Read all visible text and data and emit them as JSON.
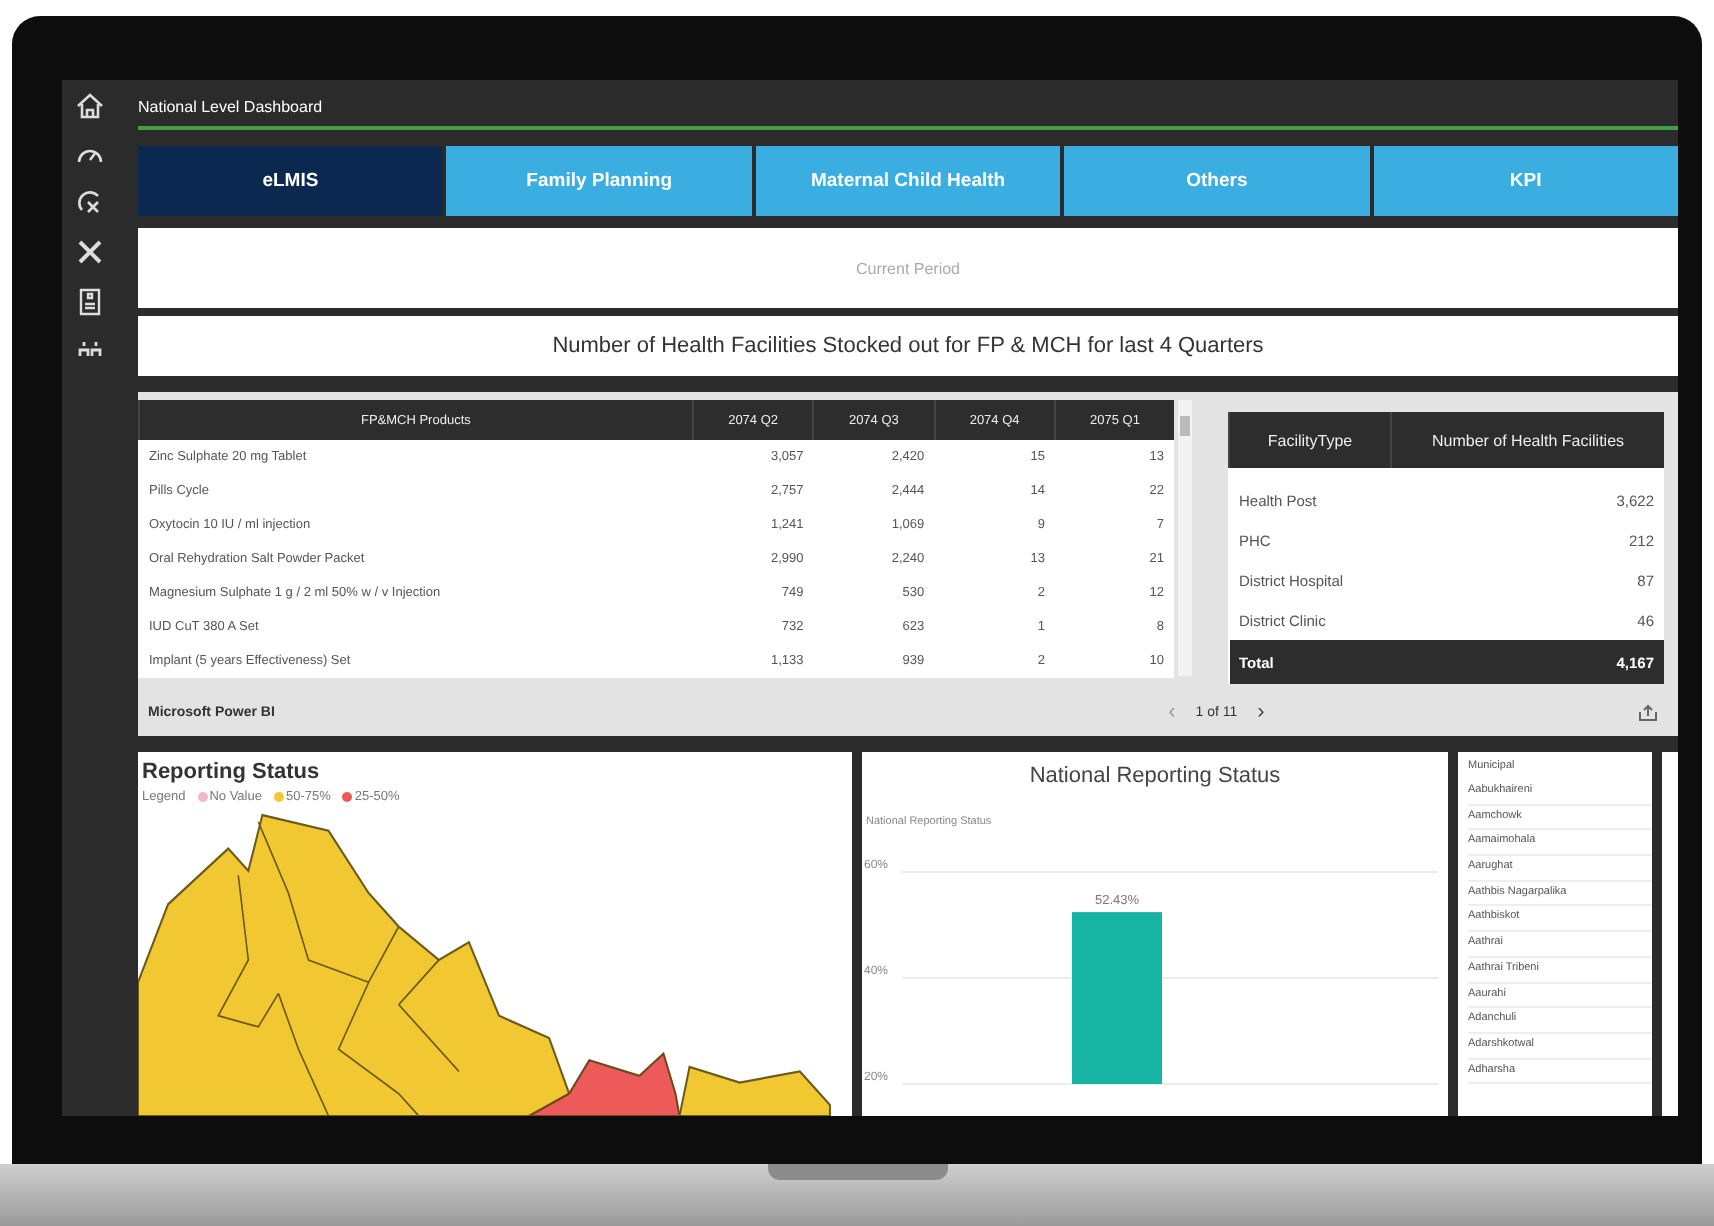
{
  "report_tab": {
    "label": "National Level Dashboard",
    "selected": true
  },
  "tabs": [
    {
      "label": "eLMIS",
      "selected": true
    },
    {
      "label": "Family Planning",
      "selected": false
    },
    {
      "label": "Maternal Child Health",
      "selected": false
    },
    {
      "label": "Others",
      "selected": false
    },
    {
      "label": "KPI",
      "selected": false
    }
  ],
  "period": {
    "placeholder": "Current Period"
  },
  "stockout": {
    "title": "Number of Health Facilities Stocked out for FP & MCH for last 4 Quarters",
    "products_table": {
      "columns": [
        "FP&MCH Products",
        "2074 Q2",
        "2074 Q3",
        "2074 Q4",
        "2075 Q1"
      ],
      "rows": [
        [
          "Zinc Sulphate 20 mg Tablet",
          "3,057",
          "2,420",
          "15",
          "13"
        ],
        [
          "Pills Cycle",
          "2,757",
          "2,444",
          "14",
          "22"
        ],
        [
          "Oxytocin 10 IU / ml injection",
          "1,241",
          "1,069",
          "9",
          "7"
        ],
        [
          "Oral Rehydration Salt Powder Packet",
          "2,990",
          "2,240",
          "13",
          "21"
        ],
        [
          "Magnesium Sulphate 1 g / 2 ml 50% w / v Injection",
          "749",
          "530",
          "2",
          "12"
        ],
        [
          "IUD CuT 380 A Set",
          "732",
          "623",
          "1",
          "8"
        ],
        [
          "Implant (5 years Effectiveness) Set",
          "1,133",
          "939",
          "2",
          "10"
        ]
      ]
    },
    "facility_table": {
      "columns": [
        "FacilityType",
        "Number of Health Facilities"
      ],
      "rows": [
        [
          "Health Post",
          "3,622"
        ],
        [
          "PHC",
          "212"
        ],
        [
          "District Hospital",
          "87"
        ],
        [
          "District Clinic",
          "46"
        ]
      ],
      "total": [
        "Total",
        "4,167"
      ]
    },
    "footer": {
      "brand": "Microsoft Power BI",
      "page": "1 of 11",
      "prev": "‹",
      "next": "›"
    }
  },
  "reporting_map": {
    "title": "Reporting Status",
    "legend_label": "Legend",
    "legend": [
      {
        "label": "No Value",
        "color": "#f4b6c8"
      },
      {
        "label": "50-75%",
        "color": "#f2c832"
      },
      {
        "label": "25-50%",
        "color": "#ee5a5a"
      }
    ]
  },
  "national_chart": {
    "chart_data": {
      "type": "bar",
      "title": "National Reporting Status",
      "ylabel": "National Reporting Status",
      "values": [
        52.43
      ],
      "ylim": [
        20,
        60
      ],
      "yticks": [
        {
          "value": 20,
          "label": "20%"
        },
        {
          "value": 40,
          "label": "40%"
        },
        {
          "value": 60,
          "label": "60%"
        }
      ],
      "value_labels": [
        "52.43%"
      ]
    }
  },
  "municipal_slicer": {
    "header": "Municipal",
    "items": [
      "Aabukhaireni",
      "Aamchowk",
      "Aamaimohala",
      "Aarughat",
      "Aathbis Nagarpalika",
      "Aathbiskot",
      "Aathrai",
      "Aathrai Tribeni",
      "Aaurahi",
      "Adanchuli",
      "Adarshkotwal",
      "Adharsha"
    ]
  }
}
